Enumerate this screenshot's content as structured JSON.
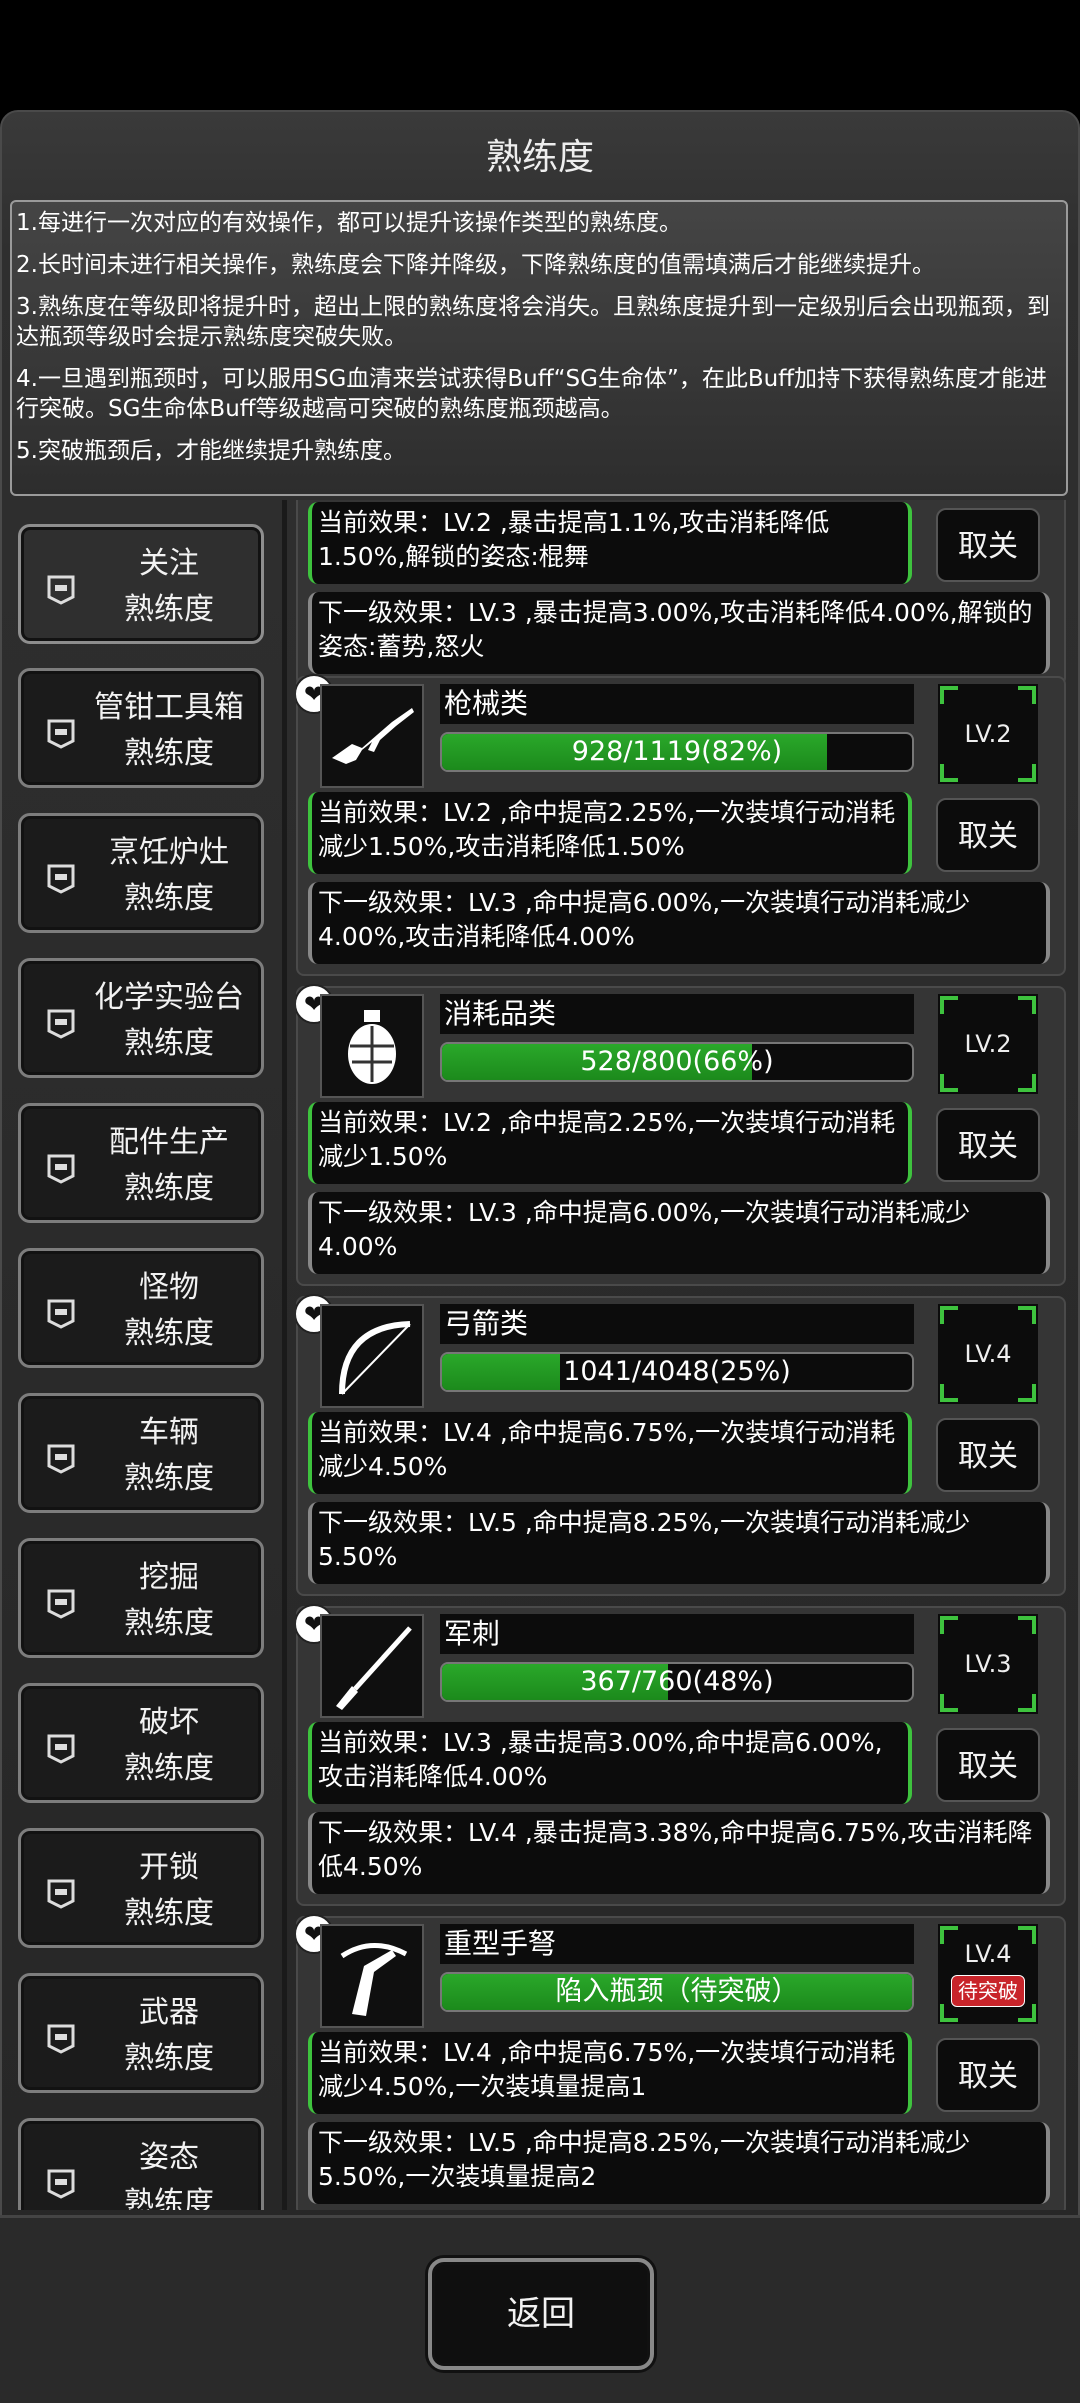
{
  "title": "熟练度",
  "info": [
    "1.每进行一次对应的有效操作，都可以提升该操作类型的熟练度。",
    "2.长时间未进行相关操作，熟练度会下降并降级，下降熟练度的值需填满后才能继续提升。",
    "3.熟练度在等级即将提升时，超出上限的熟练度将会消失。且熟练度提升到一定级别后会出现瓶颈，到达瓶颈等级时会提示熟练度突破失败。",
    "4.一旦遇到瓶颈时，可以服用SG血清来尝试获得Buff“SG生命体”，在此Buff加持下获得熟练度才能进行突破。SG生命体Buff等级越高可突破的熟练度瓶颈越高。",
    "5.突破瓶颈后，才能继续提升熟练度。"
  ],
  "sidebar": [
    {
      "line1": "关注",
      "line2": "熟练度"
    },
    {
      "line1": "管钳工具箱",
      "line2": "熟练度"
    },
    {
      "line1": "烹饪炉灶",
      "line2": "熟练度"
    },
    {
      "line1": "化学实验台",
      "line2": "熟练度"
    },
    {
      "line1": "配件生产",
      "line2": "熟练度"
    },
    {
      "line1": "怪物",
      "line2": "熟练度"
    },
    {
      "line1": "车辆",
      "line2": "熟练度"
    },
    {
      "line1": "挖掘",
      "line2": "熟练度"
    },
    {
      "line1": "破坏",
      "line2": "熟练度"
    },
    {
      "line1": "开锁",
      "line2": "熟练度"
    },
    {
      "line1": "武器",
      "line2": "熟练度"
    },
    {
      "line1": "姿态",
      "line2": "熟练度"
    }
  ],
  "partial_card": {
    "cur": "当前效果：LV.2 ,暴击提高1.1%,攻击消耗降低1.50%,解锁的姿态:棍舞",
    "close": "取关",
    "next": "下一级效果：LV.3 ,暴击提高3.00%,攻击消耗降低4.00%,解锁的姿态:蓄势,怒火"
  },
  "cards": [
    {
      "name": "枪械类",
      "icon": "rifle-icon",
      "progress": "928/1119(82%)",
      "pct": 0.82,
      "level": "LV.2",
      "cur": "当前效果：LV.2 ,命中提高2.25%,一次装填行动消耗减少1.50%,攻击消耗降低1.50%",
      "next": "下一级效果：LV.3 ,命中提高6.00%,一次装填行动消耗减少4.00%,攻击消耗降低4.00%",
      "close": "取关"
    },
    {
      "name": "消耗品类",
      "icon": "grenade-icon",
      "progress": "528/800(66%)",
      "pct": 0.66,
      "level": "LV.2",
      "cur": "当前效果：LV.2 ,命中提高2.25%,一次装填行动消耗减少1.50%",
      "next": "下一级效果：LV.3 ,命中提高6.00%,一次装填行动消耗减少4.00%",
      "close": "取关"
    },
    {
      "name": "弓箭类",
      "icon": "bow-icon",
      "progress": "1041/4048(25%)",
      "pct": 0.25,
      "level": "LV.4",
      "cur": "当前效果：LV.4 ,命中提高6.75%,一次装填行动消耗减少4.50%",
      "next": "下一级效果：LV.5 ,命中提高8.25%,一次装填行动消耗减少5.50%",
      "close": "取关"
    },
    {
      "name": "军刺",
      "icon": "bayonet-icon",
      "progress": "367/760(48%)",
      "pct": 0.48,
      "level": "LV.3",
      "cur": "当前效果：LV.3 ,暴击提高3.00%,命中提高6.00%,攻击消耗降低4.00%",
      "next": "下一级效果：LV.4 ,暴击提高3.38%,命中提高6.75%,攻击消耗降低4.50%",
      "close": "取关"
    },
    {
      "name": "重型手弩",
      "icon": "crossbow-icon",
      "progress": "陷入瓶颈（待突破）",
      "pct": 1.0,
      "level": "LV.4",
      "break_tag": "待突破",
      "cur": "当前效果：LV.4 ,命中提高6.75%,一次装填行动消耗减少4.50%,一次装填量提高1",
      "next": "下一级效果：LV.5 ,命中提高8.25%,一次装填行动消耗减少5.50%,一次装填量提高2",
      "close": "取关"
    }
  ],
  "back_label": "返回"
}
